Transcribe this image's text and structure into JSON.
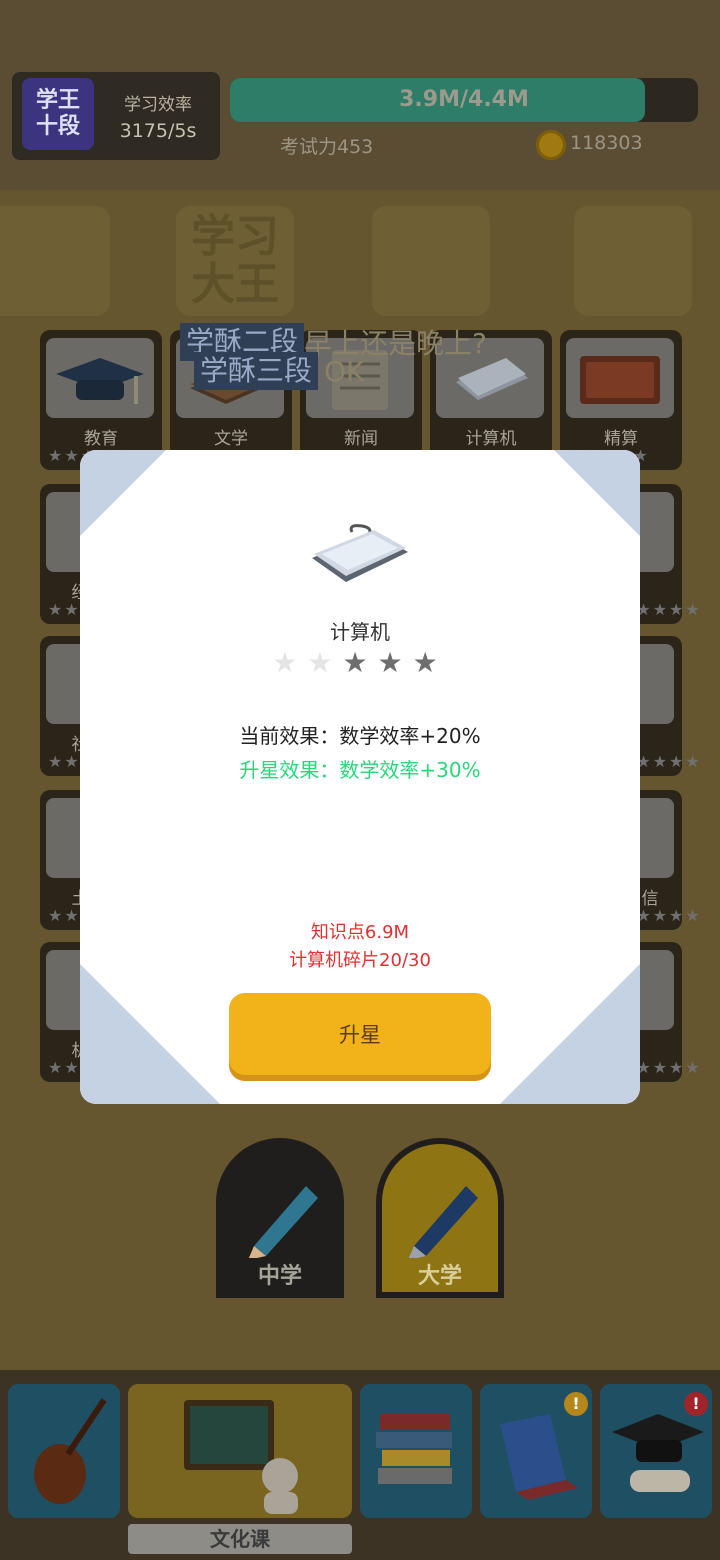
{
  "header": {
    "rank_line1": "学王",
    "rank_line2": "十段",
    "efficiency_label": "学习效率",
    "efficiency_value": "3175/5s",
    "progress_text": "3.9M/4.4M",
    "progress_fraction": 0.886,
    "exam_power": "考试力453",
    "coins": "118303"
  },
  "background": {
    "watermark_text": "学习大王",
    "cards": [
      {
        "label": "教育",
        "icon": "graduation-cap-icon"
      },
      {
        "label": "文学",
        "icon": "book-icon"
      },
      {
        "label": "新闻",
        "icon": "newspaper-icon"
      },
      {
        "label": "计算机",
        "icon": "keyboard-icon"
      },
      {
        "label": "精算",
        "icon": "abacus-icon"
      }
    ],
    "partial_labels": {
      "left_row2": "经",
      "left_row3": "社",
      "left_row4": "土",
      "right_row4": "信",
      "left_row5": "机"
    },
    "star_glyph": "★★★★★"
  },
  "toasts": {
    "toast1": "学酥二段",
    "toast1_tail": "早上还是晚上?",
    "toast2": "学酥三段",
    "toast2_tail": "OK"
  },
  "stage_tabs": [
    {
      "label": "中学",
      "icon": "pencil-icon"
    },
    {
      "label": "大学",
      "icon": "pen-icon"
    }
  ],
  "bottom_nav": {
    "active_label": "文化课",
    "items": [
      {
        "icon": "violin-icon"
      },
      {
        "icon": "chalkboard-icon"
      },
      {
        "icon": "book-stack-icon"
      },
      {
        "icon": "essay-book-icon",
        "badge": "!"
      },
      {
        "icon": "graduation-cap-icon",
        "badge": "!"
      }
    ]
  },
  "modal": {
    "item_name": "计算机",
    "stars_total": 5,
    "stars_filled": 3,
    "current_effect": "当前效果：数学效率+20%",
    "upgrade_effect": "升星效果：数学效率+30%",
    "cost_knowledge": "知识点6.9M",
    "cost_fragments": "计算机碎片20/30",
    "upgrade_button": "升星"
  },
  "colors": {
    "accent_gold": "#f2b31a",
    "upgrade_green": "#2bd67a",
    "cost_red": "#e23030",
    "modal_corner": "#c5d2e4"
  }
}
